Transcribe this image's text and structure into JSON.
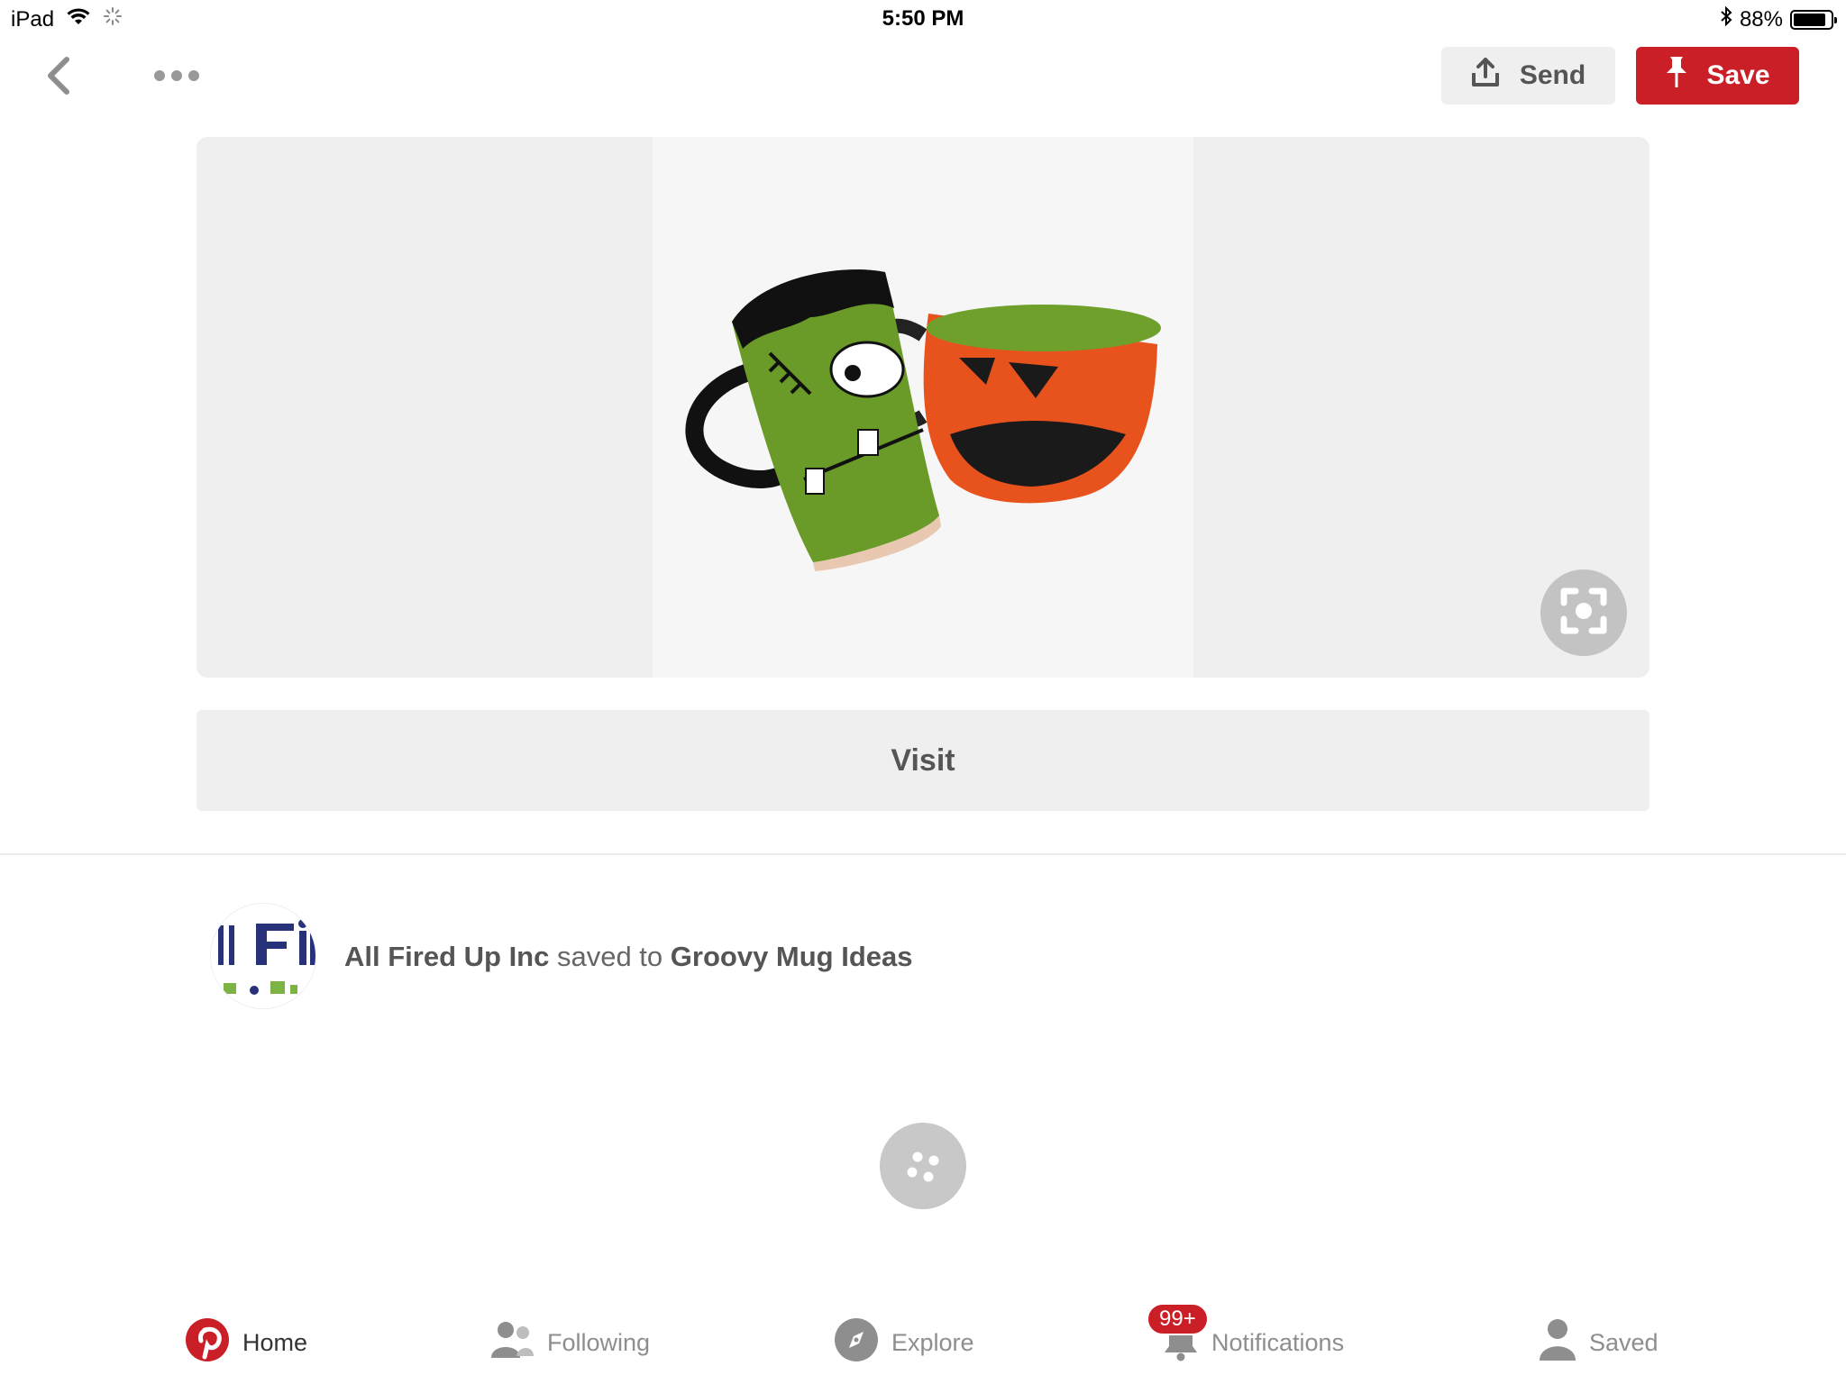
{
  "status_bar": {
    "device": "iPad",
    "time": "5:50 PM",
    "battery_percent": "88%",
    "battery_level": 0.88,
    "icons": [
      "wifi-icon",
      "activity-spinner-icon",
      "bluetooth-icon",
      "battery-icon"
    ]
  },
  "toolbar": {
    "back_icon": "chevron-left-icon",
    "more_icon": "ellipsis-icon",
    "send_label": "Send",
    "send_icon": "share-upload-icon",
    "save_label": "Save",
    "save_icon": "pushpin-icon"
  },
  "pin": {
    "image_subject": "frankenstein-and-jack-o-lantern-mugs",
    "lens_icon": "visual-search-icon",
    "visit_label": "Visit"
  },
  "attribution": {
    "user": "All Fired Up Inc",
    "connector": " saved to ",
    "board": "Groovy Mug Ideas",
    "avatar_icon": "all-fired-up-logo"
  },
  "tabs": [
    {
      "label": "Home",
      "icon": "pinterest-logo-icon",
      "active": true
    },
    {
      "label": "Following",
      "icon": "people-icon",
      "active": false
    },
    {
      "label": "Explore",
      "icon": "compass-icon",
      "active": false
    },
    {
      "label": "Notifications",
      "icon": "bell-icon",
      "active": false
    },
    {
      "label": "Saved",
      "icon": "person-icon",
      "active": false
    }
  ],
  "notifications_badge": "99+",
  "colors": {
    "brand_red": "#cb1f27",
    "button_gray": "#efefef",
    "text_gray": "#555555"
  }
}
